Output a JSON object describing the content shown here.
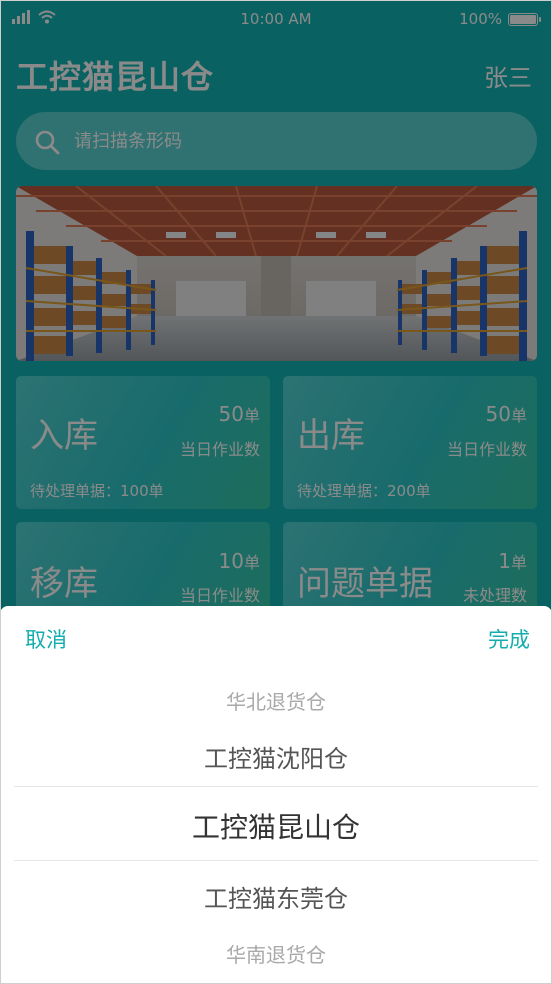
{
  "status_bar": {
    "time": "10:00 AM",
    "battery": "100%"
  },
  "header": {
    "title": "工控猫昆山仓",
    "user": "张三"
  },
  "search": {
    "placeholder": "请扫描条形码"
  },
  "cards": [
    {
      "title": "入库",
      "count": "50",
      "unit": "单",
      "sub": "当日作业数",
      "pending": "待处理单据：100单"
    },
    {
      "title": "出库",
      "count": "50",
      "unit": "单",
      "sub": "当日作业数",
      "pending": "待处理单据：200单"
    },
    {
      "title": "移库",
      "count": "10",
      "unit": "单",
      "sub": "当日作业数"
    },
    {
      "title": "问题单据",
      "count": "1",
      "unit": "单",
      "sub": "未处理数"
    }
  ],
  "picker": {
    "cancel": "取消",
    "done": "完成",
    "items": [
      "华北退货仓",
      "工控猫沈阳仓",
      "工控猫昆山仓",
      "工控猫东莞仓",
      "华南退货仓"
    ],
    "selected": "工控猫昆山仓"
  },
  "colors": {
    "accent": "#12b3b4",
    "link": "#12adae"
  }
}
